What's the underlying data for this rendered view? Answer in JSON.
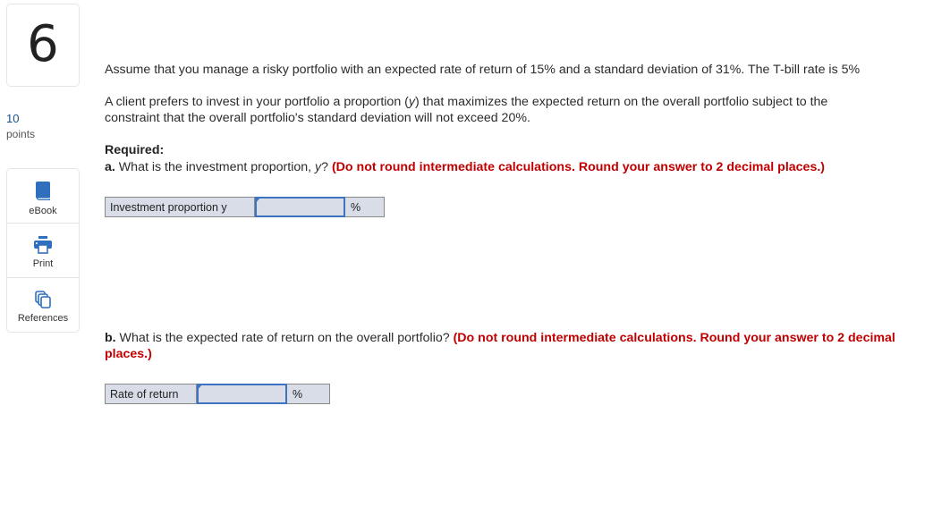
{
  "question": {
    "number": "6",
    "points_value": "10",
    "points_label": "points"
  },
  "tools": [
    {
      "label": "eBook",
      "icon": "book-icon"
    },
    {
      "label": "Print",
      "icon": "printer-icon"
    },
    {
      "label": "References",
      "icon": "documents-icon"
    }
  ],
  "prompt": {
    "paragraph1": "Assume that you manage a risky portfolio with an expected rate of return of 15% and a standard deviation of 31%. The T-bill rate is 5%",
    "paragraph2_part1": "A client prefers to invest in your portfolio a proportion (",
    "paragraph2_var": "y",
    "paragraph2_part2": ") that maximizes the expected return on the overall portfolio subject to the",
    "paragraph2_line2": "constraint that the overall portfolio's standard deviation will not exceed 20%.",
    "required_label": "Required:"
  },
  "part_a": {
    "letter": "a.",
    "question_part1": " What is the investment proportion, ",
    "question_var": "y",
    "question_part2": "? ",
    "instruction": "(Do not round intermediate calculations. Round your answer to 2 decimal places.)",
    "answer_label": "Investment proportion y",
    "answer_value": "",
    "answer_unit": "%"
  },
  "part_b": {
    "letter": "b.",
    "question": " What is the expected rate of return on the overall portfolio? ",
    "instruction": "(Do not round intermediate calculations. Round your answer to 2 decimal places.)",
    "answer_label": "Rate of return",
    "answer_value": "",
    "answer_unit": "%"
  },
  "colors": {
    "accent_blue": "#3d73c1",
    "instruction_red": "#c00000",
    "points_blue": "#1a4e8a",
    "answer_bg": "#d9dde8"
  }
}
